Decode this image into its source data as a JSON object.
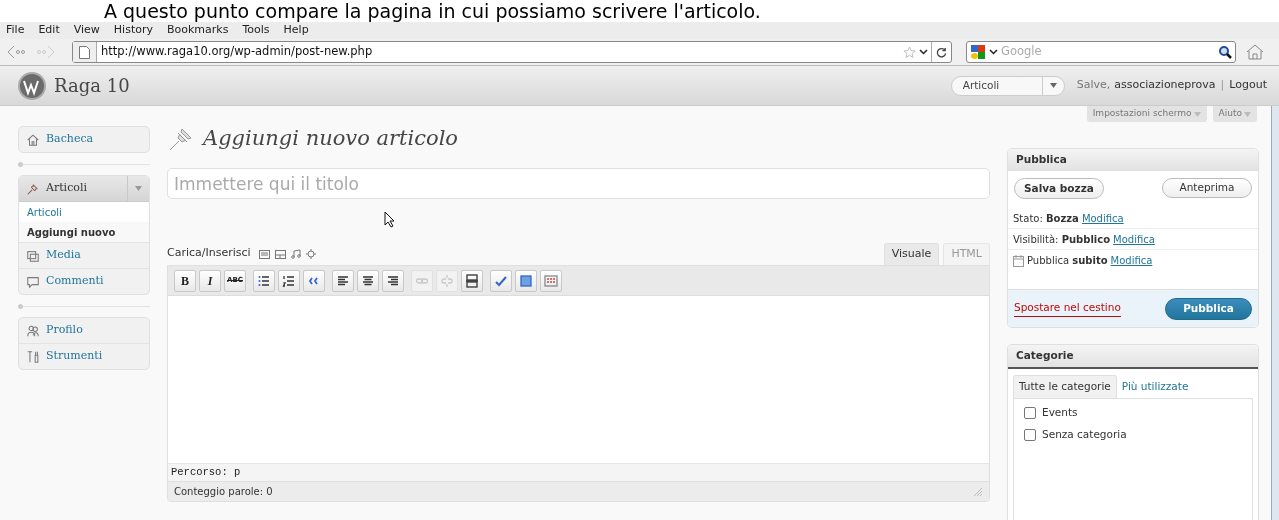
{
  "caption": "A questo punto compare la pagina in cui possiamo scrivere l'articolo.",
  "menu": [
    "File",
    "Edit",
    "View",
    "History",
    "Bookmarks",
    "Tools",
    "Help"
  ],
  "address": {
    "value": "http://www.raga10.org/wp-admin/post-new.php"
  },
  "search": {
    "placeholder": "Google"
  },
  "header": {
    "site": "Raga 10",
    "dropdown": "Articoli",
    "greeting": "Salve,",
    "user": "associazioneprova",
    "separator": "|",
    "logout": "Logout"
  },
  "screen_tabs": [
    {
      "label": "Impostazioni schermo"
    },
    {
      "label": "Aiuto"
    }
  ],
  "sidebar": {
    "groups": [
      {
        "items": [
          {
            "kind": "dashboard",
            "label": "Bacheca",
            "expanded": false
          }
        ]
      },
      {
        "items": [
          {
            "kind": "posts",
            "label": "Articoli",
            "expanded": true,
            "children": [
              {
                "label": "Articoli",
                "selected": false
              },
              {
                "label": "Aggiungi nuovo",
                "selected": true
              }
            ]
          },
          {
            "kind": "media",
            "label": "Media",
            "expanded": false
          },
          {
            "kind": "comments",
            "label": "Commenti",
            "expanded": false
          }
        ]
      },
      {
        "items": [
          {
            "kind": "profile",
            "label": "Profilo",
            "expanded": false
          },
          {
            "kind": "tools",
            "label": "Strumenti",
            "expanded": false
          }
        ]
      }
    ]
  },
  "page_title": "Aggiungi nuovo articolo",
  "title_field": {
    "placeholder": "Immettere qui il titolo"
  },
  "upload_label": "Carica/Inserisci",
  "editor_tabs": [
    {
      "label": "Visuale",
      "selected": true
    },
    {
      "label": "HTML",
      "selected": false
    }
  ],
  "toolbar": [
    {
      "kind": "bold",
      "label": "B",
      "disabled": false
    },
    {
      "kind": "italic",
      "label": "I",
      "disabled": false
    },
    {
      "kind": "strike",
      "label": "ABC",
      "disabled": false
    },
    {
      "kind": "bullets",
      "disabled": false
    },
    {
      "kind": "numbers",
      "disabled": false
    },
    {
      "kind": "quote",
      "disabled": false
    },
    {
      "kind": "align-left",
      "disabled": false
    },
    {
      "kind": "align-center",
      "disabled": false
    },
    {
      "kind": "align-right",
      "disabled": false
    },
    {
      "kind": "link",
      "disabled": true
    },
    {
      "kind": "unlink",
      "disabled": true
    },
    {
      "kind": "more",
      "disabled": false
    },
    {
      "kind": "spellcheck",
      "disabled": false
    },
    {
      "kind": "fullscreen",
      "disabled": false
    },
    {
      "kind": "kitchen-sink",
      "disabled": false
    }
  ],
  "path": "Percorso: p",
  "word_count": "Conteggio parole: 0",
  "publish": {
    "title": "Pubblica",
    "save": "Salva bozza",
    "preview": "Anteprima",
    "rows": [
      {
        "kind": "status",
        "text": "Stato: **Bozza**",
        "link": "Modifica"
      },
      {
        "kind": "visibility",
        "text": "Visibilità: **Pubblico**",
        "link": "Modifica"
      },
      {
        "kind": "schedule",
        "text": "Pubblica **subito**",
        "link": "Modifica"
      }
    ],
    "trash": "Spostare nel cestino",
    "publish_button": "Pubblica"
  },
  "categories": {
    "title": "Categorie",
    "tabs": [
      {
        "label": "Tutte le categorie",
        "selected": true
      },
      {
        "label": "Più utilizzate",
        "selected": false
      }
    ],
    "items": [
      {
        "label": "Events",
        "checked": false
      },
      {
        "label": "Senza categoria",
        "checked": false
      }
    ]
  }
}
